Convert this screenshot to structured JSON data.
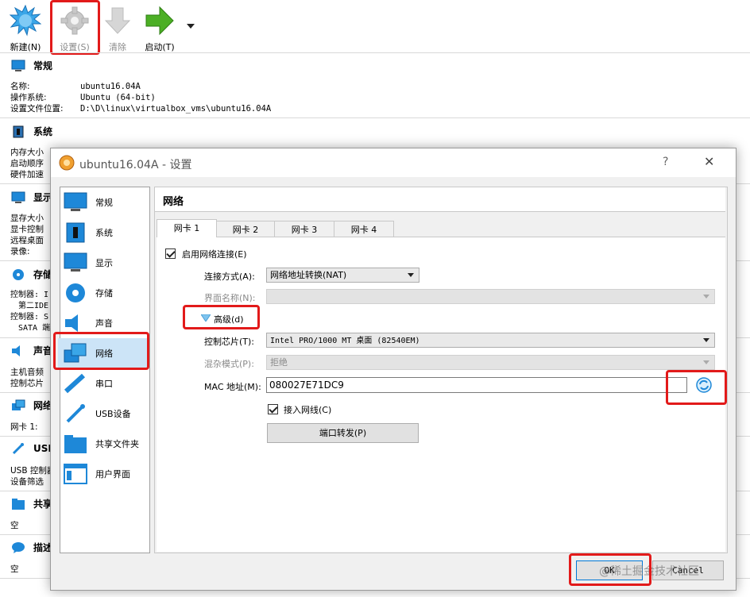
{
  "toolbar": {
    "new_label": "新建(N)",
    "settings_label": "设置(S)",
    "clear_label": "清除",
    "start_label": "启动(T)"
  },
  "details": {
    "general": {
      "title": "常规",
      "name_key": "名称:",
      "name_val": "ubuntu16.04A",
      "os_key": "操作系统:",
      "os_val": "Ubuntu (64-bit)",
      "loc_key": "设置文件位置:",
      "loc_val": "D:\\D\\linux\\virtualbox_vms\\ubuntu16.04A"
    },
    "system": {
      "title": "系统",
      "lines": [
        "内存大小",
        "启动顺序",
        "硬件加速"
      ]
    },
    "display": {
      "title": "显示",
      "lines": [
        "显存大小",
        "显卡控制",
        "远程桌面",
        "录像:"
      ]
    },
    "storage": {
      "title": "存储",
      "lines": [
        "控制器: I",
        "  第二IDE",
        "控制器: S",
        "  SATA 端"
      ]
    },
    "audio": {
      "title": "声音",
      "lines": [
        "主机音频",
        "控制芯片"
      ]
    },
    "network": {
      "title": "网络",
      "lines": [
        "网卡 1:"
      ]
    },
    "usb": {
      "title": "USB",
      "lines": [
        "USB 控制器",
        "设备筛选"
      ]
    },
    "shared": {
      "title": "共享",
      "lines": [
        "空"
      ]
    },
    "description": {
      "title": "描述",
      "lines": [
        "空"
      ]
    }
  },
  "dialog": {
    "title": "ubuntu16.04A - 设置",
    "help": "?",
    "close": "✕",
    "nav": [
      {
        "label": "常规"
      },
      {
        "label": "系统"
      },
      {
        "label": "显示"
      },
      {
        "label": "存储"
      },
      {
        "label": "声音"
      },
      {
        "label": "网络"
      },
      {
        "label": "串口"
      },
      {
        "label": "USB设备"
      },
      {
        "label": "共享文件夹"
      },
      {
        "label": "用户界面"
      }
    ],
    "selected_nav": "网络",
    "header": "网络",
    "tabs": [
      "网卡 1",
      "网卡 2",
      "网卡 3",
      "网卡 4"
    ],
    "active_tab": "网卡 1",
    "enable_label": "启用网络连接(E)",
    "attach_label": "连接方式(A):",
    "attach_value": "网络地址转换(NAT)",
    "iface_label": "界面名称(N):",
    "iface_value": "",
    "advanced_label": "高级(d)",
    "chip_label": "控制芯片(T):",
    "chip_value": "Intel PRO/1000 MT 桌面 (82540EM)",
    "promisc_label": "混杂模式(P):",
    "promisc_value": "拒绝",
    "mac_label": "MAC 地址(M):",
    "mac_value": "080027E71DC9",
    "cable_label": "接入网线(C)",
    "portfwd_label": "端口转发(P)",
    "ok_label": "OK",
    "cancel_label": "Cancel",
    "watermark": "@稀土掘金技术社区"
  },
  "colors": {
    "highlight_red": "#e21a1a",
    "nav_selected": "#cce4f7",
    "arrow_green": "#4caf25",
    "accent_blue": "#1e88d8"
  }
}
